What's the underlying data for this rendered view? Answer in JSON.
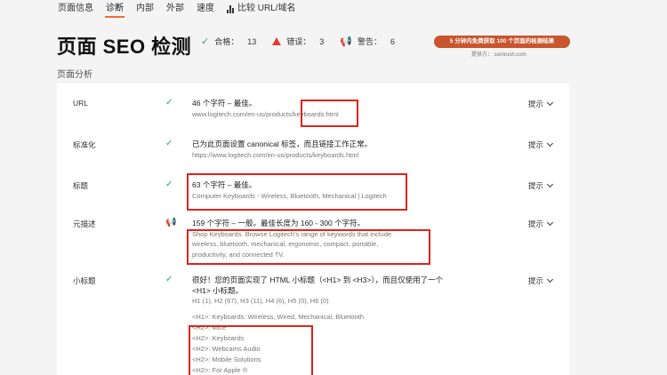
{
  "nav": {
    "tabs": [
      "页面信息",
      "诊断",
      "内部",
      "外部",
      "速度"
    ],
    "compare_label": "比较 URL/域名"
  },
  "header": {
    "title": "页面 SEO 检测",
    "stats": {
      "pass_label": "合格：",
      "pass_count": "13",
      "error_label": "错误：",
      "error_count": "3",
      "warn_label": "警告：",
      "warn_count": "6"
    },
    "promo": "5 分钟内免费获取 100 个页面的检测结果",
    "provider": "提供方： semrush.com"
  },
  "section_title": "页面分析",
  "rows": {
    "url": {
      "label": "URL",
      "main": "46 个字符 – 最佳。",
      "sub_prefix": "www.logitech.com/en-us/products/",
      "sub_highlight": "keyboards.html",
      "hint": "提示"
    },
    "canonical": {
      "label": "标准化",
      "main": "已为此页面设置 canonical 标签，而且链接工作正常。",
      "sub": "https://www.logitech.com/en-us/products/keyboards.html",
      "hint": "提示"
    },
    "title": {
      "label": "标题",
      "main": "63 个字符 – 最佳。",
      "sub": "Computer Keyboards - Wireless, Bluetooth, Mechanical | Logitech",
      "hint": "提示"
    },
    "meta": {
      "label": "元描述",
      "main": "159 个字符 – 一般。最佳长度为 160 - 300 个字符。",
      "sub": "Shop Keyboards. Browse Logitech's range of keywords that include wireless, bluetooth, mechanical, ergonomic, compact, portable, productivity, and connected TV.",
      "hint": "提示"
    },
    "headings": {
      "label": "小标题",
      "main": "很好！您的页面实现了 HTML 小标题（<H1> 到 <H3>），而且仅使用了一个 <H1> 小标题。",
      "counts": "H1 (1), H2 (67), H3 (11), H4 (6), H5 (0), H6 (0)",
      "h1": "<H1>: Keyboards: Wireless, Wired, Mechanical, Bluetooth",
      "h2_items": [
        "<H2>: Mice",
        "<H2>: Keyboards",
        "<H2>: Webcams Audio",
        "<H2>: Mobile Solutions",
        "<H2>: For Apple ®"
      ],
      "hint": "提示"
    }
  },
  "colors": {
    "accent": "#ef6b3b",
    "promo_bg": "#c8552d",
    "ok": "#2fa36b",
    "error": "#e53935",
    "warning": "#1e88e5",
    "highlight_box": "#e0241b"
  },
  "icons": {
    "pass": "check-icon",
    "error": "warning-triangle-icon",
    "warning": "megaphone-icon",
    "compare": "bar-chart-icon",
    "hint": "chevron-down-icon"
  }
}
